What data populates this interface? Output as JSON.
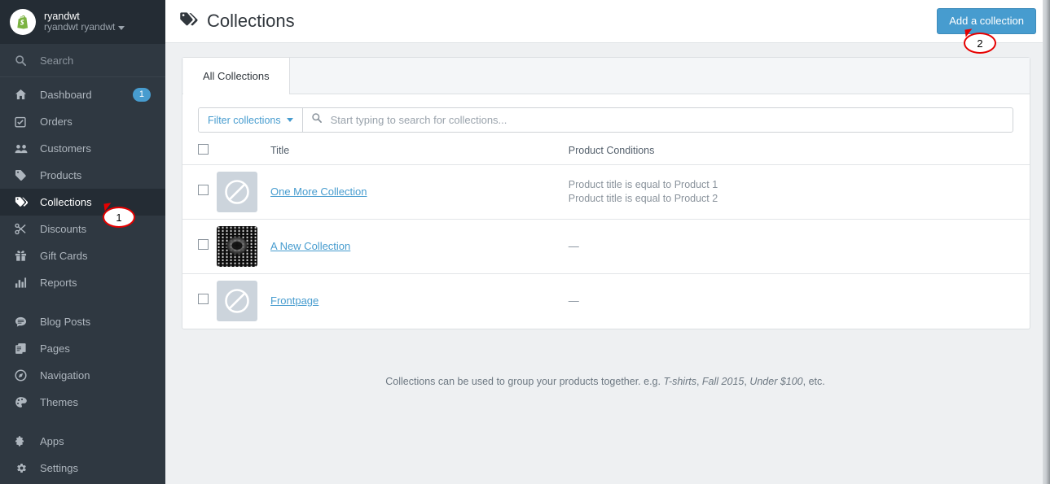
{
  "sidebar": {
    "shop": {
      "name": "ryandwt",
      "owner": "ryandwt ryandwt",
      "logo_icon": "shopify-bag-icon",
      "caret_icon": "chevron-down-icon"
    },
    "search": {
      "label": "Search",
      "icon": "search-icon"
    },
    "items": [
      {
        "label": "Dashboard",
        "icon": "home-icon",
        "badge": "1",
        "active": false
      },
      {
        "label": "Orders",
        "icon": "orders-icon",
        "badge": "",
        "active": false
      },
      {
        "label": "Customers",
        "icon": "customers-icon",
        "badge": "",
        "active": false
      },
      {
        "label": "Products",
        "icon": "tag-icon",
        "badge": "",
        "active": false
      },
      {
        "label": "Collections",
        "icon": "collections-icon",
        "badge": "",
        "active": true
      },
      {
        "label": "Discounts",
        "icon": "scissors-icon",
        "badge": "",
        "active": false
      },
      {
        "label": "Gift Cards",
        "icon": "gift-icon",
        "badge": "",
        "active": false
      },
      {
        "label": "Reports",
        "icon": "bar-chart-icon",
        "badge": "",
        "active": false
      }
    ],
    "items2": [
      {
        "label": "Blog Posts",
        "icon": "chat-icon",
        "active": false
      },
      {
        "label": "Pages",
        "icon": "pages-icon",
        "active": false
      },
      {
        "label": "Navigation",
        "icon": "compass-icon",
        "active": false
      },
      {
        "label": "Themes",
        "icon": "paintbrush-icon",
        "active": false
      }
    ],
    "items3": [
      {
        "label": "Apps",
        "icon": "puzzle-icon",
        "active": false
      },
      {
        "label": "Settings",
        "icon": "gear-icon",
        "active": false
      }
    ]
  },
  "header": {
    "title": "Collections",
    "title_icon": "collections-tag-icon",
    "add_button": "Add a collection"
  },
  "tabs": [
    {
      "label": "All Collections",
      "active": true
    }
  ],
  "filter": {
    "button_label": "Filter collections",
    "caret_icon": "chevron-down-icon",
    "search_icon": "search-icon",
    "search_placeholder": "Start typing to search for collections...",
    "search_value": ""
  },
  "table": {
    "columns": [
      "",
      "",
      "Title",
      "Product Conditions"
    ],
    "rows": [
      {
        "title": "One More Collection",
        "thumb": "no-image-placeholder",
        "conditions": [
          "Product title is equal to Product 1",
          "Product title is equal to Product 2"
        ]
      },
      {
        "title": "A New Collection",
        "thumb": "dark-mesh-image",
        "conditions": [
          "—"
        ]
      },
      {
        "title": "Frontpage",
        "thumb": "no-image-placeholder",
        "conditions": [
          "—"
        ]
      }
    ]
  },
  "footnote": {
    "part1": "Collections can be used to group your products together. e.g. ",
    "em1": "T-shirts",
    "sep1": ", ",
    "em2": "Fall 2015",
    "sep2": ", ",
    "em3": "Under $100",
    "part2": ", etc."
  },
  "markers": [
    {
      "label": "1"
    },
    {
      "label": "2"
    }
  ],
  "colors": {
    "sidebar_bg": "#2f3841",
    "sidebar_header_bg": "#242c34",
    "accent_blue": "#479ccf",
    "marker_red": "#e60000",
    "page_bg": "#eef0f2"
  }
}
